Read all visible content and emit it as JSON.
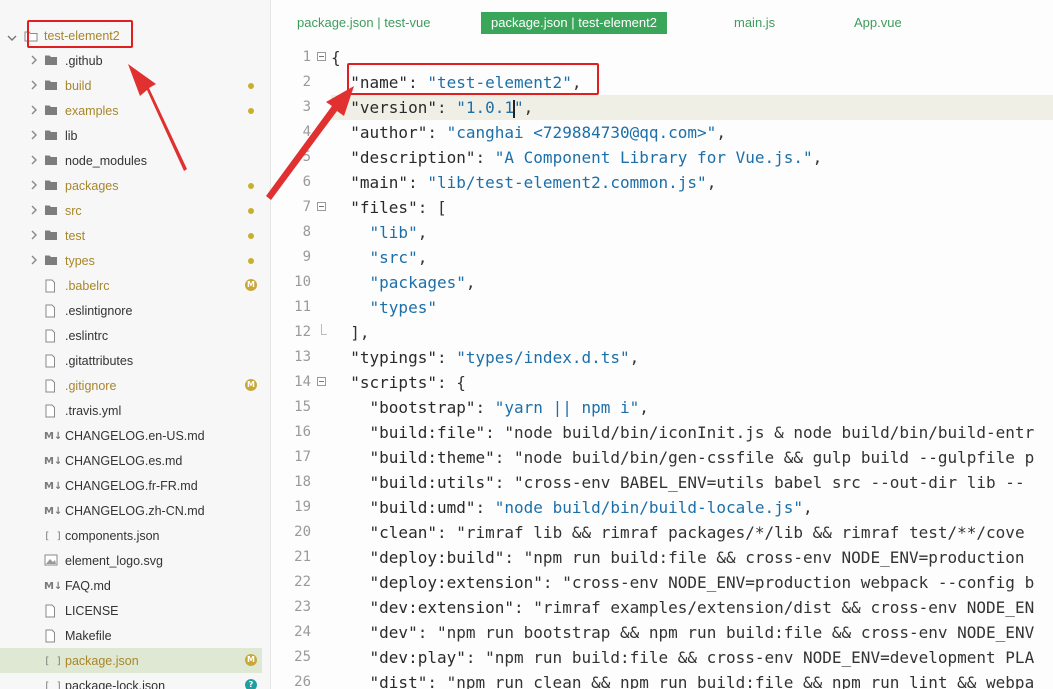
{
  "explorer": {
    "root": {
      "name": "test-element2"
    },
    "items": [
      {
        "name": ".github",
        "kind": "folder",
        "git": false,
        "badge": ""
      },
      {
        "name": "build",
        "kind": "folder",
        "git": true,
        "badge": "dot"
      },
      {
        "name": "examples",
        "kind": "folder",
        "git": true,
        "badge": "dot"
      },
      {
        "name": "lib",
        "kind": "folder",
        "git": false,
        "badge": ""
      },
      {
        "name": "node_modules",
        "kind": "folder",
        "git": false,
        "badge": ""
      },
      {
        "name": "packages",
        "kind": "folder",
        "git": true,
        "badge": "dot"
      },
      {
        "name": "src",
        "kind": "folder",
        "git": true,
        "badge": "dot"
      },
      {
        "name": "test",
        "kind": "folder",
        "git": true,
        "badge": "dot"
      },
      {
        "name": "types",
        "kind": "folder",
        "git": true,
        "badge": "dot"
      },
      {
        "name": ".babelrc",
        "kind": "file",
        "git": true,
        "badge": "M"
      },
      {
        "name": ".eslintignore",
        "kind": "file",
        "git": false,
        "badge": ""
      },
      {
        "name": ".eslintrc",
        "kind": "file",
        "git": false,
        "badge": ""
      },
      {
        "name": ".gitattributes",
        "kind": "file",
        "git": false,
        "badge": ""
      },
      {
        "name": ".gitignore",
        "kind": "file",
        "git": true,
        "badge": "M"
      },
      {
        "name": ".travis.yml",
        "kind": "file",
        "git": false,
        "badge": ""
      },
      {
        "name": "CHANGELOG.en-US.md",
        "kind": "md",
        "git": false,
        "badge": ""
      },
      {
        "name": "CHANGELOG.es.md",
        "kind": "md",
        "git": false,
        "badge": ""
      },
      {
        "name": "CHANGELOG.fr-FR.md",
        "kind": "md",
        "git": false,
        "badge": ""
      },
      {
        "name": "CHANGELOG.zh-CN.md",
        "kind": "md",
        "git": false,
        "badge": ""
      },
      {
        "name": "components.json",
        "kind": "json",
        "git": false,
        "badge": ""
      },
      {
        "name": "element_logo.svg",
        "kind": "image",
        "git": false,
        "badge": ""
      },
      {
        "name": "FAQ.md",
        "kind": "md",
        "git": false,
        "badge": ""
      },
      {
        "name": "LICENSE",
        "kind": "file",
        "git": false,
        "badge": ""
      },
      {
        "name": "Makefile",
        "kind": "file",
        "git": false,
        "badge": ""
      },
      {
        "name": "package.json",
        "kind": "json",
        "git": true,
        "badge": "M",
        "active": true
      },
      {
        "name": "package-lock.json",
        "kind": "json",
        "git": false,
        "badge": "?"
      }
    ]
  },
  "tabs": [
    {
      "label": "package.json | test-vue",
      "active": false
    },
    {
      "label": "package.json | test-element2",
      "active": true
    },
    {
      "label": "main.js",
      "active": false
    },
    {
      "label": "App.vue",
      "active": false
    }
  ],
  "editor": {
    "current_line": 3,
    "lines": [
      {
        "n": 1,
        "fold": "open",
        "text": "{"
      },
      {
        "n": 2,
        "fold": "",
        "text": "  \"name\": \"test-element2\","
      },
      {
        "n": 3,
        "fold": "",
        "text": "  \"version\": \"1.0.1\","
      },
      {
        "n": 4,
        "fold": "",
        "text": "  \"author\": \"canghai <729884730@qq.com>\","
      },
      {
        "n": 5,
        "fold": "",
        "text": "  \"description\": \"A Component Library for Vue.js.\","
      },
      {
        "n": 6,
        "fold": "",
        "text": "  \"main\": \"lib/test-element2.common.js\","
      },
      {
        "n": 7,
        "fold": "open",
        "text": "  \"files\": ["
      },
      {
        "n": 8,
        "fold": "",
        "text": "    \"lib\","
      },
      {
        "n": 9,
        "fold": "",
        "text": "    \"src\","
      },
      {
        "n": 10,
        "fold": "",
        "text": "    \"packages\","
      },
      {
        "n": 11,
        "fold": "",
        "text": "    \"types\""
      },
      {
        "n": 12,
        "fold": "end",
        "text": "  ],"
      },
      {
        "n": 13,
        "fold": "",
        "text": "  \"typings\": \"types/index.d.ts\","
      },
      {
        "n": 14,
        "fold": "open",
        "text": "  \"scripts\": {"
      },
      {
        "n": 15,
        "fold": "",
        "text": "    \"bootstrap\": \"yarn || npm i\","
      },
      {
        "n": 16,
        "fold": "",
        "text": "    \"build:file\": \"node build/bin/iconInit.js & node build/bin/build-entr"
      },
      {
        "n": 17,
        "fold": "",
        "text": "    \"build:theme\": \"node build/bin/gen-cssfile && gulp build --gulpfile p"
      },
      {
        "n": 18,
        "fold": "",
        "text": "    \"build:utils\": \"cross-env BABEL_ENV=utils babel src --out-dir lib --"
      },
      {
        "n": 19,
        "fold": "",
        "text": "    \"build:umd\": \"node build/bin/build-locale.js\","
      },
      {
        "n": 20,
        "fold": "",
        "text": "    \"clean\": \"rimraf lib && rimraf packages/*/lib && rimraf test/**/cove"
      },
      {
        "n": 21,
        "fold": "",
        "text": "    \"deploy:build\": \"npm run build:file && cross-env NODE_ENV=production"
      },
      {
        "n": 22,
        "fold": "",
        "text": "    \"deploy:extension\": \"cross-env NODE_ENV=production webpack --config b"
      },
      {
        "n": 23,
        "fold": "",
        "text": "    \"dev:extension\": \"rimraf examples/extension/dist && cross-env NODE_EN"
      },
      {
        "n": 24,
        "fold": "",
        "text": "    \"dev\": \"npm run bootstrap && npm run build:file && cross-env NODE_ENV"
      },
      {
        "n": 25,
        "fold": "",
        "text": "    \"dev:play\": \"npm run build:file && cross-env NODE_ENV=development PLA"
      },
      {
        "n": 26,
        "fold": "",
        "text": "    \"dist\": \"npm run clean && npm run build:file && npm run lint && webpa"
      }
    ]
  },
  "colors": {
    "accent": "#3aa65a",
    "git_modified": "#a8862b",
    "string": "#1c6fa8",
    "annotation": "#e02020"
  }
}
